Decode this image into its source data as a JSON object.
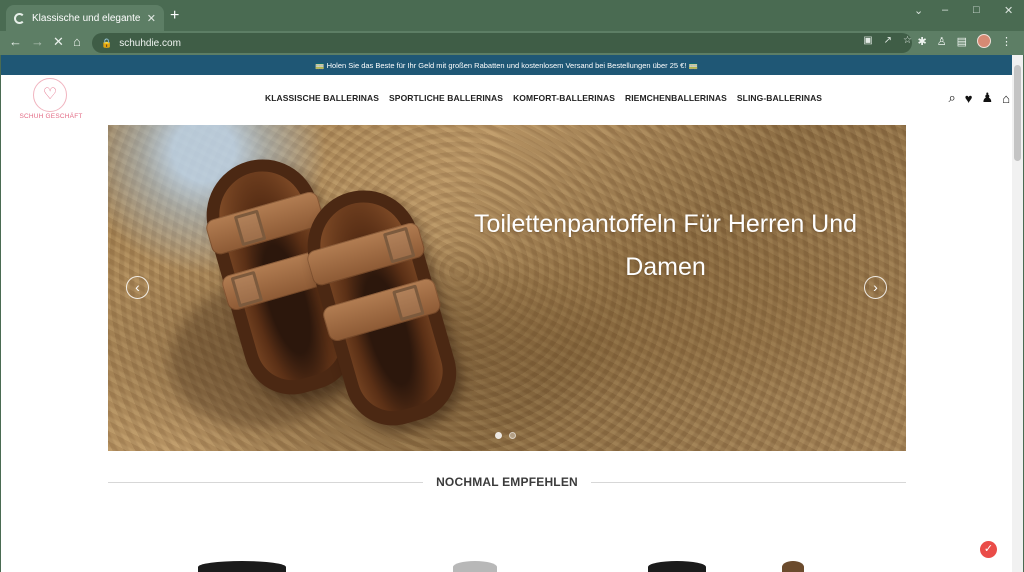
{
  "browser": {
    "tab_title": "Klassische und elegante Damen",
    "url": "schuhdie.com",
    "icons": {
      "new_tab": "+",
      "back": "←",
      "forward": "→",
      "reload": "✕",
      "home": "⌂"
    },
    "window_controls": {
      "minimize": "–",
      "maximize": "□",
      "close": "✕"
    },
    "right_icons": [
      "▣",
      "↗",
      "☆",
      "✱",
      "♙",
      "▤",
      "⋮"
    ]
  },
  "promo": {
    "text": "🚃 Holen Sie das Beste für Ihr Geld mit großen Rabatten und kostenlosem Versand bei Bestellungen über 25 €! 🚃"
  },
  "site": {
    "logo_text": "SCHUH GESCHÄFT",
    "logo_mark": "♡",
    "nav": [
      "KLASSISCHE BALLERINAS",
      "SPORTLICHE BALLERINAS",
      "KOMFORT-BALLERINAS",
      "RIEMCHENBALLERINAS",
      "SLING-BALLERINAS"
    ],
    "header_icons": {
      "search": "⌕",
      "wishlist": "♥",
      "account": "♟",
      "cart": "⌂"
    }
  },
  "hero": {
    "title": "Toilettenpantoffeln Für Herren Und Damen",
    "prev_arrow": "‹",
    "next_arrow": "›",
    "slide_count": 2,
    "active_slide": 1
  },
  "section": {
    "title": "NOCHMAL EMPFEHLEN"
  },
  "floating_button": "✓",
  "colors": {
    "chrome": "#4a6b52",
    "promo_bar": "#1f5775",
    "accent": "#e36b85"
  }
}
